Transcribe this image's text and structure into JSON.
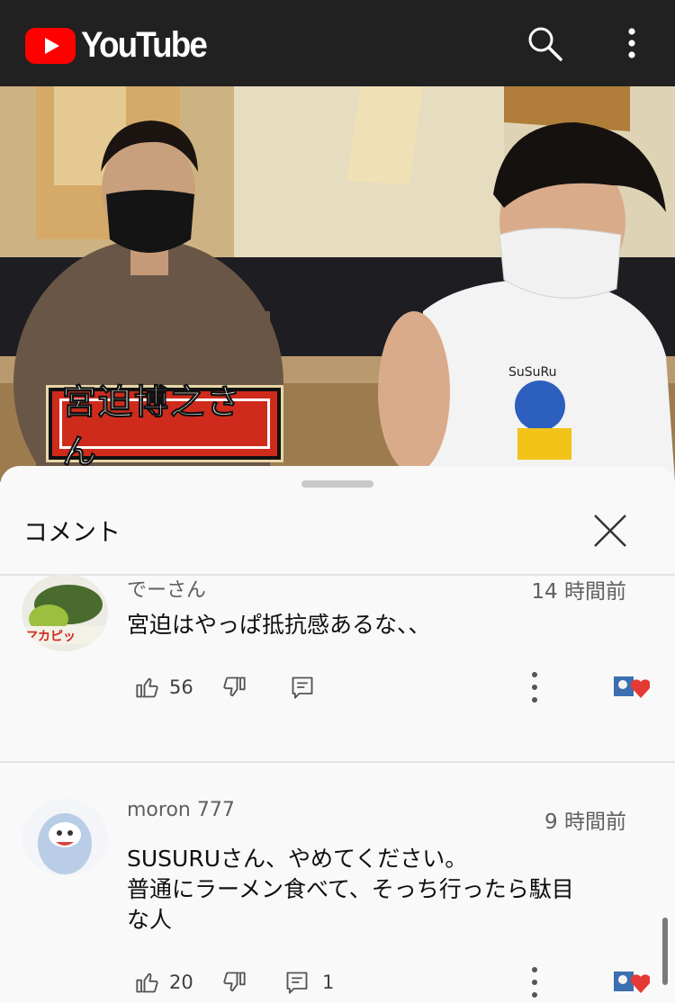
{
  "app": {
    "logo_text": "YouTube"
  },
  "video": {
    "caption_text": "宮迫博之さん",
    "shirt_text": "SuSuRu"
  },
  "comments_panel": {
    "title": "コメント",
    "comments": [
      {
        "author": "でーさん",
        "time": "14 時間前",
        "text": "宮迫はやっぱ抵抗感あるな、、",
        "likes": "56",
        "replies": ""
      },
      {
        "author": "moron 777",
        "time": "9 時間前",
        "text_line1": "SUSURUさん、やめてください。",
        "text_line2": "普通にラーメン食べて、そっち行ったら駄目",
        "text_line3": "な人",
        "likes": "20",
        "replies": "1"
      }
    ]
  },
  "colors": {
    "brand_red": "#ff0000",
    "top_bar": "#212121",
    "heart": "#e53935"
  },
  "icons": [
    "youtube-logo-icon",
    "search-icon",
    "more-vert-icon",
    "close-icon",
    "like-icon",
    "dislike-icon",
    "reply-icon",
    "heart-icon"
  ]
}
